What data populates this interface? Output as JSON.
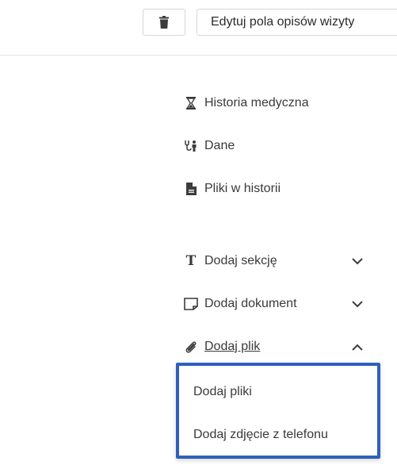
{
  "toolbar": {
    "delete_icon": "trash-icon",
    "edit_label": "Edytuj pola opisów wizyty"
  },
  "menu": {
    "history": {
      "label": "Historia medyczna",
      "icon": "hourglass-icon"
    },
    "data": {
      "label": "Dane",
      "icon": "stethoscope-icon"
    },
    "files": {
      "label": "Pliki w historii",
      "icon": "file-icon"
    },
    "add_section": {
      "label": "Dodaj sekcję",
      "icon": "text-icon"
    },
    "add_document": {
      "label": "Dodaj dokument",
      "icon": "document-icon"
    },
    "add_file": {
      "label": "Dodaj plik",
      "icon": "paperclip-icon"
    }
  },
  "dropdown": {
    "items": [
      "Dodaj pliki",
      "Dodaj zdjęcie z telefonu"
    ],
    "border_color": "#2e5fbd"
  }
}
